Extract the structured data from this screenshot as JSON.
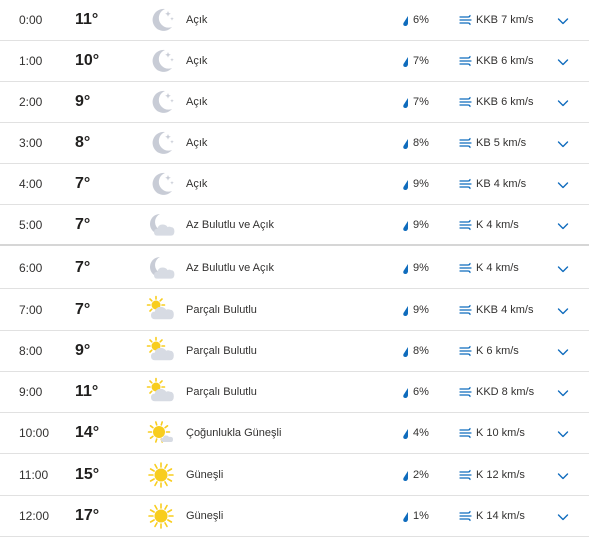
{
  "colors": {
    "accent": "#0f6cbd",
    "moon": "#c8ccd6",
    "sun": "#f8cd1e",
    "cloud": "#d7dbe3",
    "divider": "#e1e1e1"
  },
  "rows": [
    {
      "time": "0:00",
      "temp": "11°",
      "condition": "Açık",
      "icon": "moon-clear-icon",
      "precip": "6%",
      "wind": "KKB 7 km/s"
    },
    {
      "time": "1:00",
      "temp": "10°",
      "condition": "Açık",
      "icon": "moon-clear-icon",
      "precip": "7%",
      "wind": "KKB 6 km/s"
    },
    {
      "time": "2:00",
      "temp": "9°",
      "condition": "Açık",
      "icon": "moon-clear-icon",
      "precip": "7%",
      "wind": "KKB 6 km/s"
    },
    {
      "time": "3:00",
      "temp": "8°",
      "condition": "Açık",
      "icon": "moon-clear-icon",
      "precip": "8%",
      "wind": "KB 5 km/s"
    },
    {
      "time": "4:00",
      "temp": "7°",
      "condition": "Açık",
      "icon": "moon-clear-icon",
      "precip": "9%",
      "wind": "KB 4 km/s"
    },
    {
      "time": "5:00",
      "temp": "7°",
      "condition": "Az Bulutlu ve Açık",
      "icon": "moon-cloud-icon",
      "precip": "9%",
      "wind": "K 4 km/s"
    },
    {
      "time": "6:00",
      "temp": "7°",
      "condition": "Az Bulutlu ve Açık",
      "icon": "moon-cloud-icon",
      "precip": "9%",
      "wind": "K 4 km/s"
    },
    {
      "time": "7:00",
      "temp": "7°",
      "condition": "Parçalı Bulutlu",
      "icon": "sun-cloud-icon",
      "precip": "9%",
      "wind": "KKB 4 km/s"
    },
    {
      "time": "8:00",
      "temp": "9°",
      "condition": "Parçalı Bulutlu",
      "icon": "sun-cloud-icon",
      "precip": "8%",
      "wind": "K 6 km/s"
    },
    {
      "time": "9:00",
      "temp": "11°",
      "condition": "Parçalı Bulutlu",
      "icon": "sun-cloud-icon",
      "precip": "6%",
      "wind": "KKD 8 km/s"
    },
    {
      "time": "10:00",
      "temp": "14°",
      "condition": "Çoğunlukla Güneşli",
      "icon": "sun-small-cloud-icon",
      "precip": "4%",
      "wind": "K 10 km/s"
    },
    {
      "time": "11:00",
      "temp": "15°",
      "condition": "Güneşli",
      "icon": "sun-icon",
      "precip": "2%",
      "wind": "K 12 km/s"
    },
    {
      "time": "12:00",
      "temp": "17°",
      "condition": "Güneşli",
      "icon": "sun-icon",
      "precip": "1%",
      "wind": "K 14 km/s"
    }
  ]
}
